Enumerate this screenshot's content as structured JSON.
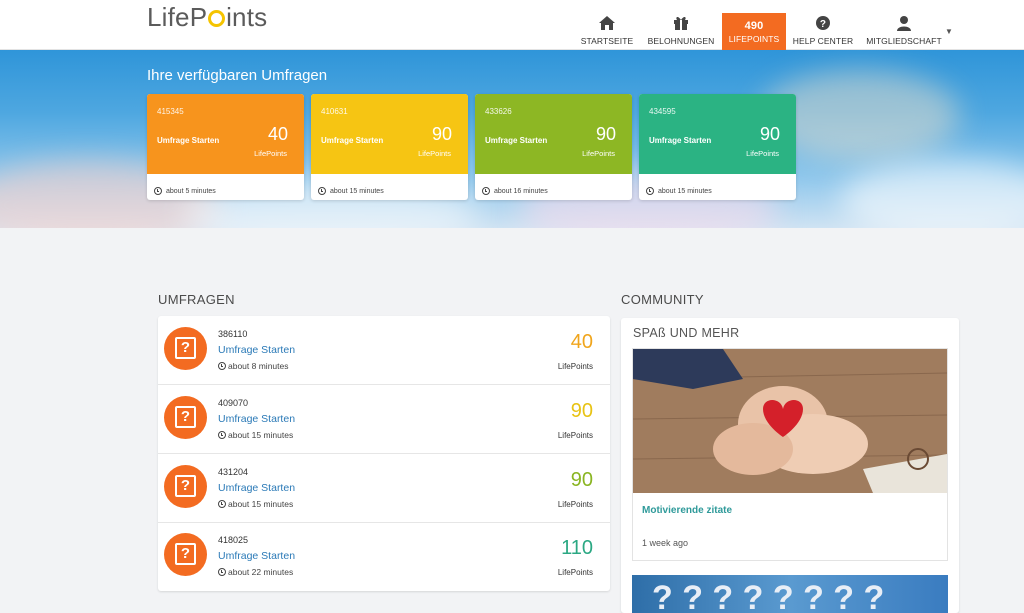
{
  "header": {
    "logo": "LifePoints",
    "nav": [
      {
        "label": "STARTSEITE",
        "icon": "home-icon"
      },
      {
        "label": "BELOHNUNGEN",
        "icon": "gift-icon"
      },
      {
        "value": "490",
        "label": "LIFEPOINTS"
      },
      {
        "label": "HELP CENTER",
        "icon": "help-icon"
      },
      {
        "label": "MITGLIEDSCHAFT",
        "icon": "user-icon"
      }
    ],
    "accent_color": "#f36b21"
  },
  "hero": {
    "title": "Ihre verfügbaren Umfragen",
    "cards": [
      {
        "id": "415345",
        "start": "Umfrage Starten",
        "points": "40",
        "points_label": "LifePoints",
        "time": "about 5 minutes",
        "color": "#f7941d"
      },
      {
        "id": "410631",
        "start": "Umfrage Starten",
        "points": "90",
        "points_label": "LifePoints",
        "time": "about 15 minutes",
        "color": "#f6c513"
      },
      {
        "id": "433626",
        "start": "Umfrage Starten",
        "points": "90",
        "points_label": "LifePoints",
        "time": "about 16 minutes",
        "color": "#8db724"
      },
      {
        "id": "434595",
        "start": "Umfrage Starten",
        "points": "90",
        "points_label": "LifePoints",
        "time": "about 15 minutes",
        "color": "#2bb383"
      }
    ]
  },
  "surveys": {
    "title": "UMFRAGEN",
    "rows": [
      {
        "id": "386110",
        "link": "Umfrage Starten",
        "time": "about 8 minutes",
        "points": "40",
        "points_label": "LifePoints",
        "color": "#f0a51c"
      },
      {
        "id": "409070",
        "link": "Umfrage Starten",
        "time": "about 15 minutes",
        "points": "90",
        "points_label": "LifePoints",
        "color": "#e8c314"
      },
      {
        "id": "431204",
        "link": "Umfrage Starten",
        "time": "about 15 minutes",
        "points": "90",
        "points_label": "LifePoints",
        "color": "#8ab522"
      },
      {
        "id": "418025",
        "link": "Umfrage Starten",
        "time": "about 22 minutes",
        "points": "110",
        "points_label": "LifePoints",
        "color": "#2ba883"
      }
    ]
  },
  "community": {
    "title": "COMMUNITY",
    "subtitle": "SPAß UND MEHR",
    "post": {
      "title": "Motivierende zitate",
      "date": "1 week ago"
    }
  }
}
